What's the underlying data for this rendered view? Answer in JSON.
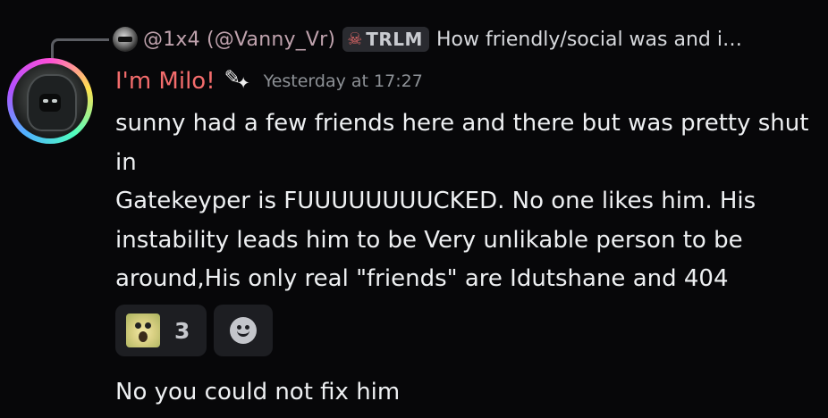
{
  "reply": {
    "author": "@1x4 (@Vanny_Vr)",
    "tag": "TRLM",
    "tag_icon": "skull-icon",
    "preview": "How friendly/social was and i…"
  },
  "message": {
    "author": "I'm Milo!",
    "author_color": "#f36c6c",
    "timestamp": "Yesterday at 17:27",
    "lines": [
      "sunny had a few friends here and there but was pretty shut in",
      "Gatekeyper is FUUUUUUUUCKED. No one likes him. His instability leads him to be Very unlikable person to be around,His only real \"friends\" are Idutshane and 404"
    ],
    "reactions": [
      {
        "emoji": "screaming-face-emoji",
        "count": "3"
      }
    ],
    "add_reaction_icon": "smiley-add-icon"
  },
  "next_message": {
    "text": "No you could not fix him"
  }
}
